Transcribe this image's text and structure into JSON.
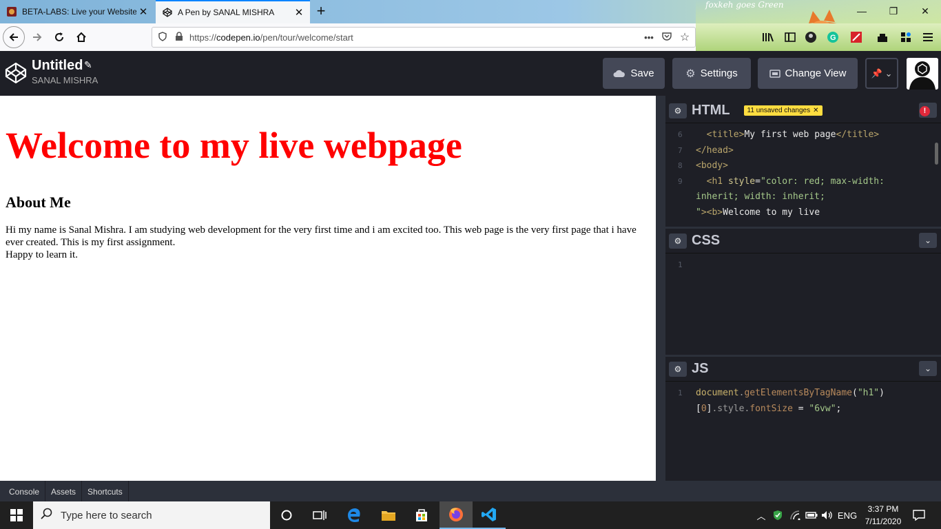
{
  "browser": {
    "tabs": [
      {
        "title": "BETA-LABS: Live your Website w",
        "active": false
      },
      {
        "title": "A Pen by SANAL MISHRA",
        "active": true
      }
    ],
    "url_prefix": "https://",
    "url_host": "codepen.io",
    "url_path": "/pen/tour/welcome/start",
    "theme_text": "foxkeh goes Green"
  },
  "codepen": {
    "pen_title": "Untitled",
    "author": "SANAL MISHRA",
    "buttons": {
      "save": "Save",
      "settings": "Settings",
      "change_view": "Change View"
    },
    "editors": {
      "html": {
        "title": "HTML",
        "badge": "11 unsaved changes",
        "lines": [
          {
            "num": "6",
            "text": "  <title>My first web page</title>"
          },
          {
            "num": "7",
            "text": "</head>"
          },
          {
            "num": "8",
            "text": "<body>"
          },
          {
            "num": "9",
            "text": "  <h1 style=\"color: red; max-width:"
          },
          {
            "num": "",
            "text": "inherit; width: inherit;"
          },
          {
            "num": "",
            "text": "\"><b>Welcome to my live"
          }
        ]
      },
      "css": {
        "title": "CSS",
        "lines": [
          {
            "num": "1",
            "text": ""
          }
        ]
      },
      "js": {
        "title": "JS",
        "lines": [
          {
            "num": "1",
            "text": "document.getElementsByTagName(\"h1\")"
          },
          {
            "num": "",
            "text": "[0].style.fontSize = \"6vw\";"
          }
        ]
      }
    },
    "bottom_bar": [
      "Console",
      "Assets",
      "Shortcuts"
    ]
  },
  "preview": {
    "heading": "Welcome to my live webpage",
    "subheading": "About Me",
    "paragraph": "Hi my name is Sanal Mishra. I am studying web development for the very first time and i am excited too. This web page is the very first page that i have ever created. This is my first assignment.",
    "paragraph2": "Happy to learn it."
  },
  "taskbar": {
    "search_placeholder": "Type here to search",
    "language": "ENG",
    "time": "3:37 PM",
    "date": "7/11/2020"
  },
  "colors": {
    "codepen_bg": "#1e1f26",
    "button_bg": "#444857",
    "badge": "#ffdd40",
    "heading_red": "#ff0000"
  }
}
